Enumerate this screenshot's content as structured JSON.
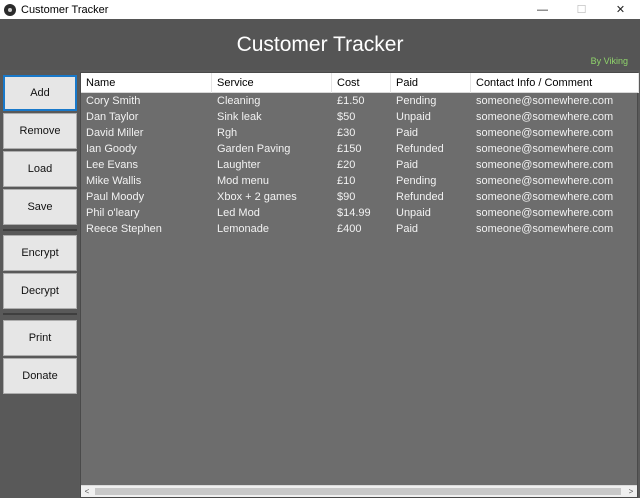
{
  "window": {
    "title": "Customer Tracker",
    "minimize": "—",
    "maximize": "☐",
    "close": "✕"
  },
  "header": {
    "title": "Customer Tracker",
    "credit": "By Viking"
  },
  "sidebar": {
    "buttons": [
      "Add",
      "Remove",
      "Load",
      "Save",
      "Encrypt",
      "Decrypt",
      "Print",
      "Donate"
    ]
  },
  "table": {
    "columns": [
      "Name",
      "Service",
      "Cost",
      "Paid",
      "Contact Info / Comment"
    ],
    "rows": [
      [
        "Cory Smith",
        "Cleaning",
        "£1.50",
        "Pending",
        "someone@somewhere.com"
      ],
      [
        "Dan Taylor",
        "Sink leak",
        "$50",
        "Unpaid",
        "someone@somewhere.com"
      ],
      [
        "David Miller",
        "Rgh",
        "£30",
        "Paid",
        "someone@somewhere.com"
      ],
      [
        "Ian Goody",
        "Garden Paving",
        "£150",
        "Refunded",
        "someone@somewhere.com"
      ],
      [
        "Lee Evans",
        "Laughter",
        "£20",
        "Paid",
        "someone@somewhere.com"
      ],
      [
        "Mike Wallis",
        "Mod menu",
        "£10",
        "Pending",
        "someone@somewhere.com"
      ],
      [
        "Paul Moody",
        "Xbox + 2 games",
        "$90",
        "Refunded",
        "someone@somewhere.com"
      ],
      [
        "Phil o'leary",
        "Led Mod",
        "$14.99",
        "Unpaid",
        "someone@somewhere.com"
      ],
      [
        "Reece Stephen",
        "Lemonade",
        "£400",
        "Paid",
        "someone@somewhere.com"
      ]
    ]
  },
  "scrollbar": {
    "left_arrow": "<",
    "right_arrow": ">"
  }
}
